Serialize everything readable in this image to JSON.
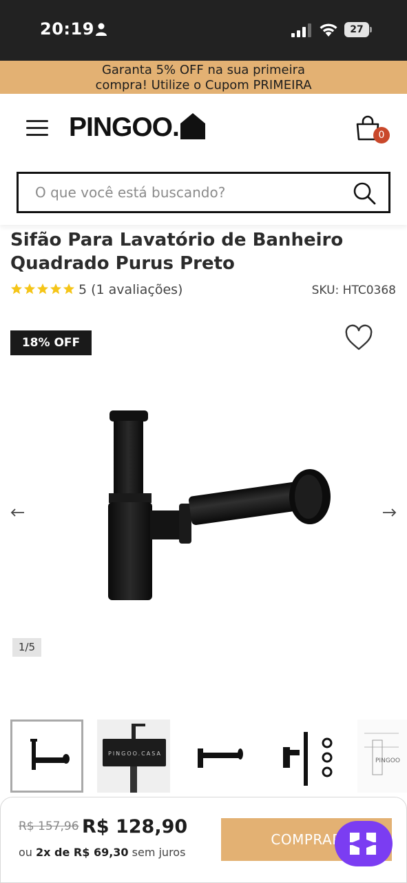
{
  "status_bar": {
    "time": "20:19",
    "battery": "27"
  },
  "promo": {
    "line1": "Garanta 5% OFF na sua primeira",
    "line2": "compra! Utilize o Cupom PRIMEIRA"
  },
  "header": {
    "logo": "PINGOO.",
    "cart_count": "0",
    "search_placeholder": "O que você está buscando?"
  },
  "product": {
    "title": "Sifão Para Lavatório de Banheiro Quadrado Purus Preto",
    "rating_text": "5 (1 avaliações)",
    "stars": 5,
    "sku": "SKU: HTC0368",
    "discount_badge": "18% OFF",
    "pager": "1/5"
  },
  "thumbnails": [
    {
      "name": "thumb-1",
      "active": true
    },
    {
      "name": "thumb-2",
      "active": false
    },
    {
      "name": "thumb-3",
      "active": false
    },
    {
      "name": "thumb-4",
      "active": false
    },
    {
      "name": "thumb-5",
      "active": false
    }
  ],
  "buy_bar": {
    "old_price": "R$ 157,96",
    "new_price": "R$ 128,90",
    "installments_prefix": "ou ",
    "installments_strong": "2x de R$ 69,30",
    "installments_suffix": " sem juros",
    "buy_label": "COMPRAR"
  },
  "colors": {
    "accent": "#e3b173",
    "badge_red": "#c9482b",
    "chat_purple": "#7b3df2",
    "star_yellow": "#f5c518"
  }
}
